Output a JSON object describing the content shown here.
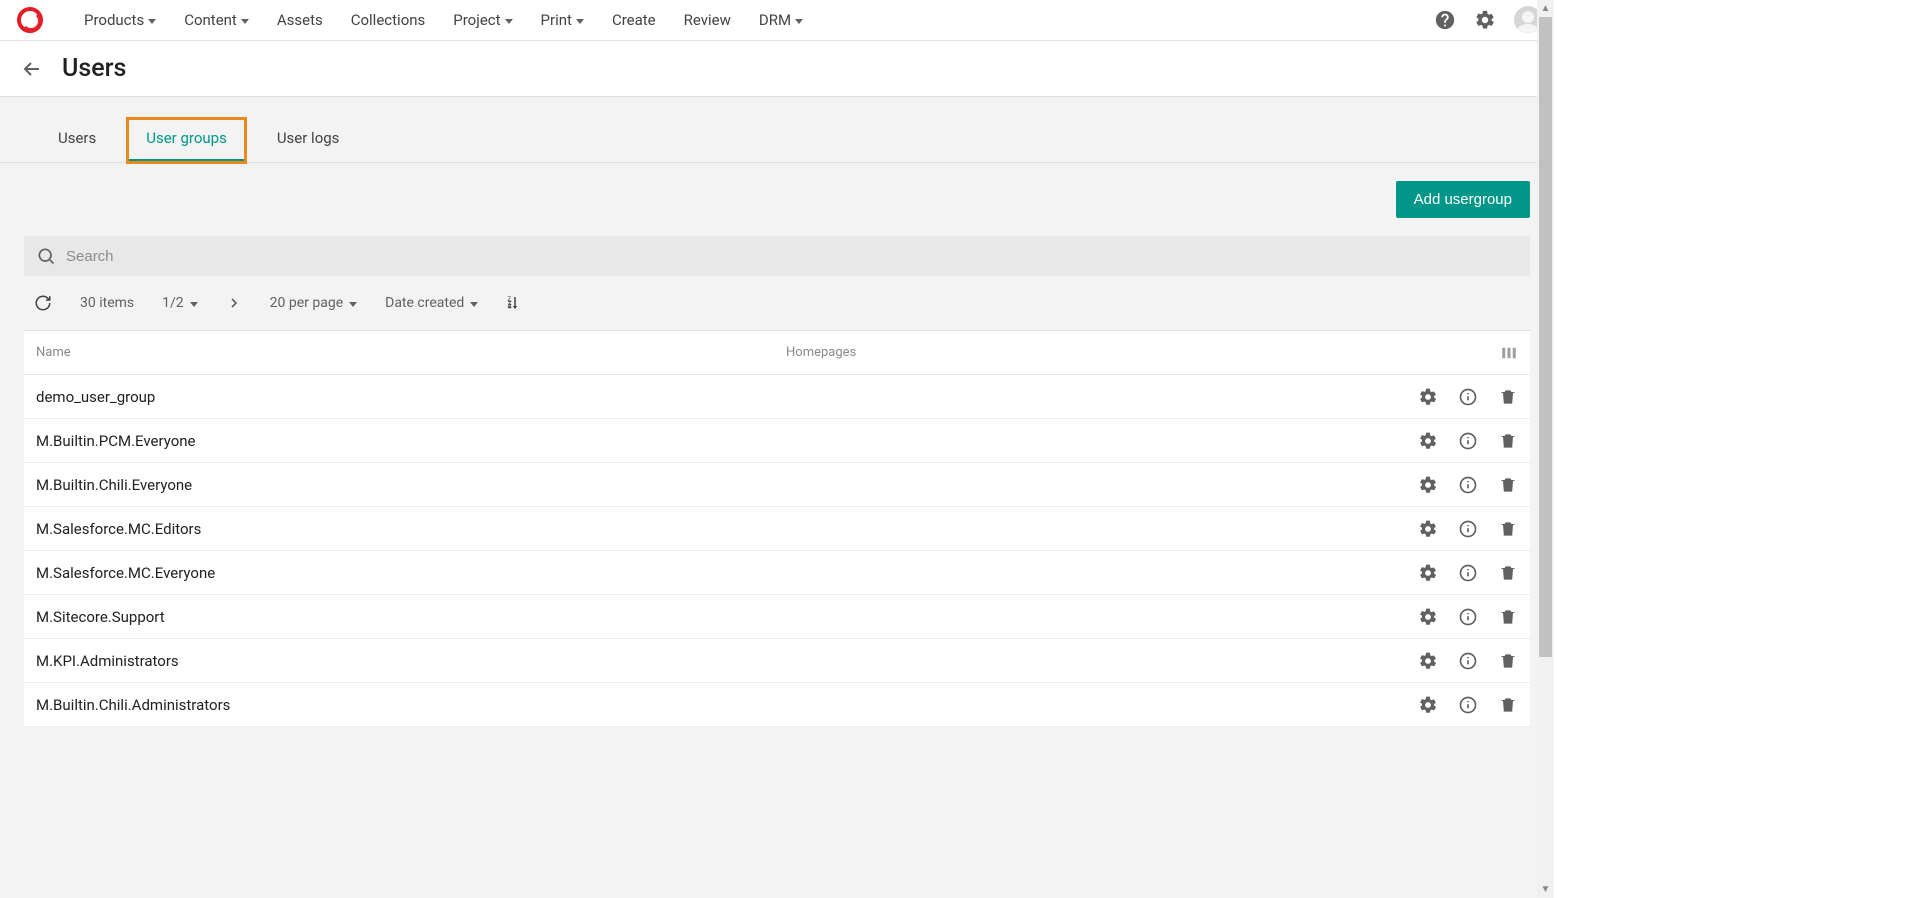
{
  "nav": {
    "items": [
      {
        "label": "Products",
        "dropdown": true
      },
      {
        "label": "Content",
        "dropdown": true
      },
      {
        "label": "Assets",
        "dropdown": false
      },
      {
        "label": "Collections",
        "dropdown": false
      },
      {
        "label": "Project",
        "dropdown": true
      },
      {
        "label": "Print",
        "dropdown": true
      },
      {
        "label": "Create",
        "dropdown": false
      },
      {
        "label": "Review",
        "dropdown": false
      },
      {
        "label": "DRM",
        "dropdown": true
      }
    ]
  },
  "page": {
    "title": "Users"
  },
  "tabs": [
    {
      "label": "Users",
      "active": false,
      "highlighted": false
    },
    {
      "label": "User groups",
      "active": true,
      "highlighted": true
    },
    {
      "label": "User logs",
      "active": false,
      "highlighted": false
    }
  ],
  "toolbar": {
    "add_button": "Add usergroup"
  },
  "search": {
    "placeholder": "Search",
    "value": ""
  },
  "meta": {
    "count": "30 items",
    "pages": "1/2",
    "per_page": "20 per page",
    "sort": "Date created"
  },
  "table": {
    "columns": {
      "name": "Name",
      "homepages": "Homepages"
    },
    "rows": [
      {
        "name": "demo_user_group",
        "homepages": ""
      },
      {
        "name": "M.Builtin.PCM.Everyone",
        "homepages": ""
      },
      {
        "name": "M.Builtin.Chili.Everyone",
        "homepages": ""
      },
      {
        "name": "M.Salesforce.MC.Editors",
        "homepages": ""
      },
      {
        "name": "M.Salesforce.MC.Everyone",
        "homepages": ""
      },
      {
        "name": "M.Sitecore.Support",
        "homepages": ""
      },
      {
        "name": "M.KPI.Administrators",
        "homepages": ""
      },
      {
        "name": "M.Builtin.Chili.Administrators",
        "homepages": ""
      }
    ]
  }
}
